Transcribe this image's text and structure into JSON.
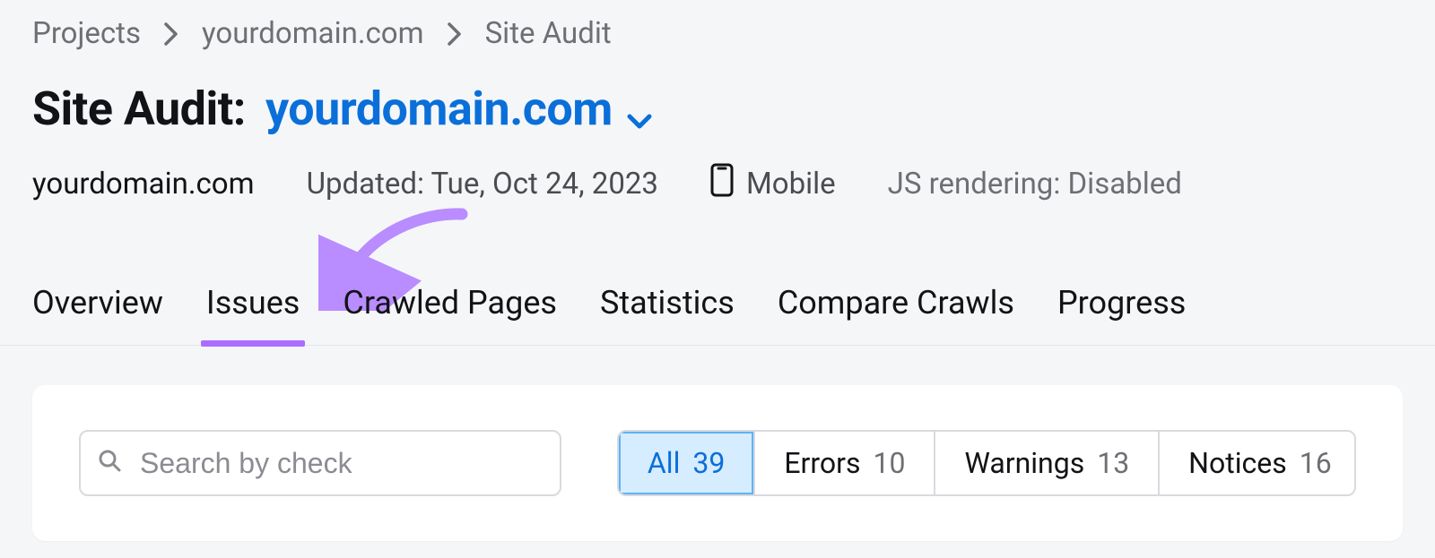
{
  "breadcrumb": {
    "items": [
      "Projects",
      "yourdomain.com",
      "Site Audit"
    ]
  },
  "title": {
    "prefix": "Site Audit:",
    "domain": "yourdomain.com"
  },
  "meta": {
    "domain": "yourdomain.com",
    "updated": "Updated: Tue, Oct 24, 2023",
    "device": "Mobile",
    "js": "JS rendering: Disabled"
  },
  "tabs": {
    "items": [
      "Overview",
      "Issues",
      "Crawled Pages",
      "Statistics",
      "Compare Crawls",
      "Progress"
    ],
    "active_index": 1
  },
  "search": {
    "placeholder": "Search by check"
  },
  "filters": {
    "items": [
      {
        "label": "All",
        "count": 39,
        "active": true
      },
      {
        "label": "Errors",
        "count": 10,
        "active": false
      },
      {
        "label": "Warnings",
        "count": 13,
        "active": false
      },
      {
        "label": "Notices",
        "count": 16,
        "active": false
      }
    ]
  },
  "colors": {
    "accent_blue": "#0a6fd9",
    "accent_purple": "#ab6cff",
    "text_muted": "#6e6f74",
    "border": "#d9dade"
  }
}
